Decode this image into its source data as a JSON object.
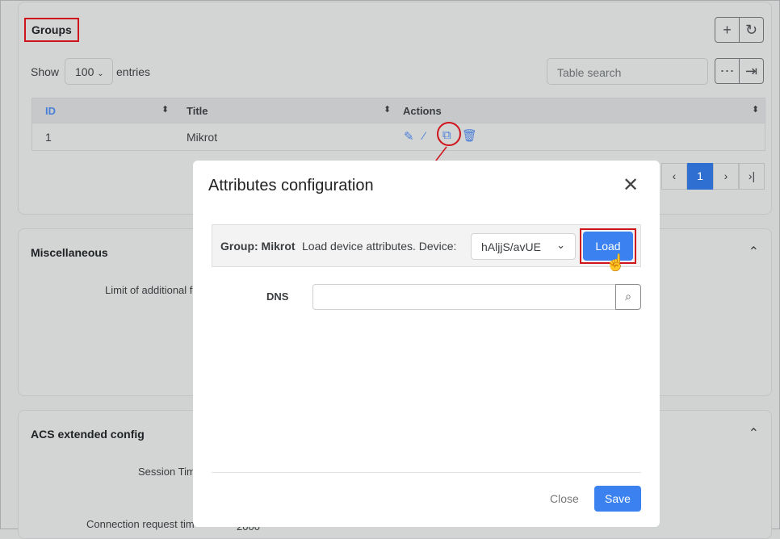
{
  "groups": {
    "title": "Groups",
    "show": "Show",
    "entries_value": "100",
    "entries": "entries",
    "search_placeholder": "Table search",
    "columns": [
      "ID",
      "Title",
      "Actions"
    ],
    "rows": [
      {
        "id": "1",
        "title": "Mikrot"
      }
    ],
    "page": "1"
  },
  "misc": {
    "title": "Miscellaneous",
    "field": "Limit of additional f"
  },
  "acs": {
    "title": "ACS extended config",
    "field1": "Session Tim",
    "field2": "Connection request tim",
    "value2": "2000"
  },
  "modal": {
    "title": "Attributes configuration",
    "group_label": "Group: Mikrot",
    "load_text": "Load device attributes. Device:",
    "device": "hAljjS/avUE",
    "load": "Load",
    "dns_label": "DNS",
    "dns_value": "",
    "close": "Close",
    "save": "Save"
  },
  "colors": {
    "accent": "#3b82f0",
    "highlight": "#d0141b"
  }
}
